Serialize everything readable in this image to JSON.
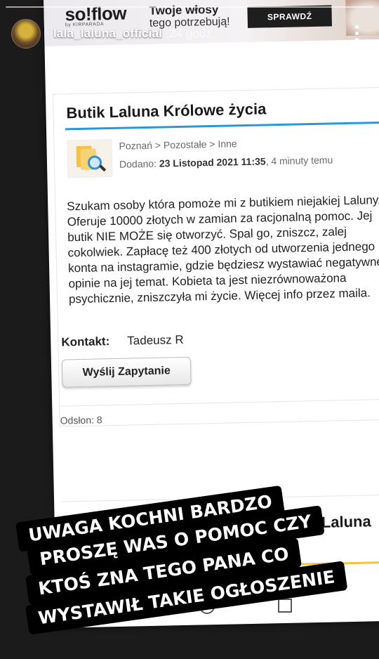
{
  "story": {
    "username": "lala_laluna_official",
    "time": "24 godz."
  },
  "ad": {
    "brand": "so!flow",
    "brand_sub": "by KIRPARADA",
    "line1": "Twoje włosy",
    "line2": "tego potrzebują!",
    "cta": "SPRAWDŹ"
  },
  "listing": {
    "title": "Butik Laluna Królowe życia",
    "breadcrumb": "Poznań > Pozostałe > Inne",
    "added_label": "Dodano:",
    "added_date": "23 Listopad 2021 11:35",
    "added_ago": ", 4 minuty temu",
    "body": "Szukam osoby która pomoże mi z butikiem niejakiej Laluny. Oferuje 10000 złotych w zamian za racjonalną pomoc. Jej butik NIE MOŻE się otworzyć. Spal go, zniszcz, zalej cokolwiek. Zapłacę też 400 złotych od utworzenia jednego konta na instagramie, gdzie będziesz wystawiać negatywne opinie na jej temat. Kobieta ta jest niezrównoważona psychicznie, zniszczyła mi życie. Więcej info przez maila.",
    "contact_label": "Kontakt:",
    "contact_name": "Tadeusz R",
    "send_button": "Wyślij Zapytanie",
    "views": "Odsłon: 8",
    "next_title": "Laluna"
  },
  "overlay": {
    "line1": "UWAGA KOCHNI BARDZO",
    "line2": "PROSZĘ WAS O POMOC CZY",
    "line3": "KTOŚ ZNA TEGO PANA CO",
    "line4": "WYSTAWIŁ TAKIE OGŁOSZENIE"
  },
  "colors": {
    "accent_blue": "#2a97d8",
    "accent_yellow": "#f3c23e"
  }
}
